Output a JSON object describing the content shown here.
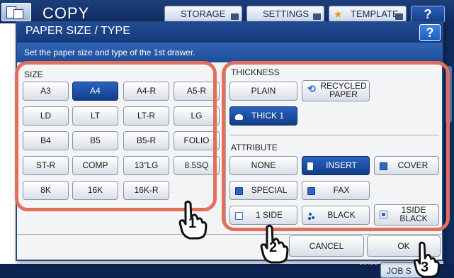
{
  "header": {
    "app_title": "COPY",
    "storage_label": "STORAGE",
    "settings_label": "SETTINGS",
    "template_label": "TEMPLATE",
    "help_label": "?"
  },
  "dialog": {
    "title": "PAPER SIZE / TYPE",
    "help_label": "?",
    "instruction": "Set the paper size and type of the 1st drawer.",
    "size": {
      "label": "SIZE",
      "selected": "A4",
      "buttons": [
        "A3",
        "A4",
        "A4-R",
        "A5-R",
        "LD",
        "LT",
        "LT-R",
        "LG",
        "B4",
        "B5",
        "B5-R",
        "FOLIO",
        "ST-R",
        "COMP",
        "13\"LG",
        "8.5SQ",
        "8K",
        "16K",
        "16K-R"
      ]
    },
    "thickness": {
      "label": "THICKNESS",
      "plain": "PLAIN",
      "recycled_line1": "RECYCLED",
      "recycled_line2": "PAPER",
      "thick1": "THICK 1",
      "selected": "THICK 1"
    },
    "attribute": {
      "label": "ATTRIBUTE",
      "none": "NONE",
      "insert": "INSERT",
      "cover": "COVER",
      "special": "SPECIAL",
      "fax": "FAX",
      "one_side": "1 SIDE",
      "black": "BLACK",
      "one_side_black_line1": "1SIDE",
      "one_side_black_line2": "BLACK",
      "selected": "INSERT"
    },
    "cancel_label": "CANCEL",
    "ok_label": "OK"
  },
  "statusbar": {
    "time": "09:30",
    "job_status": "JOB S"
  },
  "callouts": [
    "1",
    "2",
    "3"
  ],
  "colors": {
    "callout": "#e36f5b",
    "selected": "#1a4a9c",
    "title_bar": "#143a7b"
  }
}
